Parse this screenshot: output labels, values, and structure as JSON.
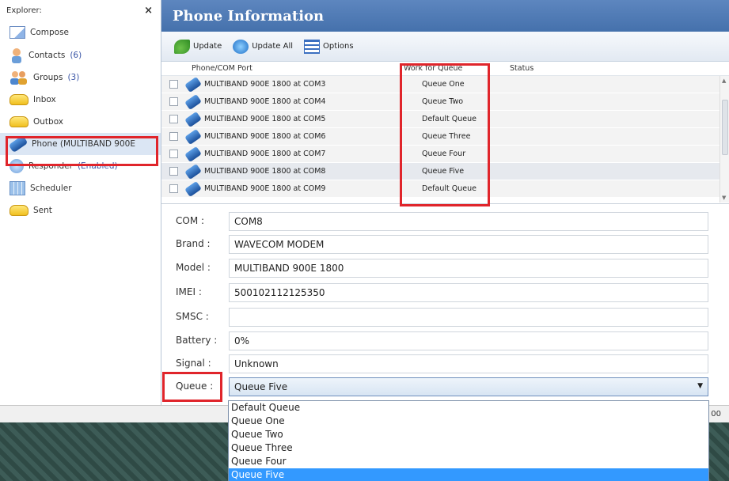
{
  "explorer": {
    "title": "Explorer:",
    "close": "×",
    "items": [
      {
        "label": "Compose",
        "count": ""
      },
      {
        "label": "Contacts",
        "count": "(6)"
      },
      {
        "label": "Groups",
        "count": "(3)"
      },
      {
        "label": "Inbox",
        "count": ""
      },
      {
        "label": "Outbox",
        "count": ""
      },
      {
        "label": "Phone  (MULTIBAND  900E",
        "count": ""
      },
      {
        "label": "Responder",
        "count": "(Enabled)"
      },
      {
        "label": "Scheduler",
        "count": ""
      },
      {
        "label": "Sent",
        "count": ""
      }
    ],
    "selected_index": 5
  },
  "panel": {
    "title": "Phone Information",
    "toolbar": {
      "update": "Update",
      "update_all": "Update All",
      "options": "Options"
    }
  },
  "grid": {
    "headers": {
      "port": "Phone/COM Port",
      "queue": "Work for Queue",
      "status": "Status"
    },
    "rows": [
      {
        "port": "MULTIBAND  900E  1800  at COM3",
        "queue": "Queue One",
        "status": ""
      },
      {
        "port": "MULTIBAND  900E  1800  at COM4",
        "queue": "Queue Two",
        "status": ""
      },
      {
        "port": "MULTIBAND  900E  1800  at COM5",
        "queue": "Default Queue",
        "status": ""
      },
      {
        "port": "MULTIBAND  900E  1800  at COM6",
        "queue": "Queue Three",
        "status": ""
      },
      {
        "port": "MULTIBAND  900E  1800  at COM7",
        "queue": "Queue Four",
        "status": ""
      },
      {
        "port": "MULTIBAND  900E  1800  at COM8",
        "queue": "Queue Five",
        "status": ""
      },
      {
        "port": "MULTIBAND  900E  1800  at COM9",
        "queue": "Default Queue",
        "status": ""
      }
    ]
  },
  "details": {
    "com": {
      "label": "COM :",
      "value": "COM8"
    },
    "brand": {
      "label": "Brand :",
      "value": "WAVECOM MODEM"
    },
    "model": {
      "label": "Model :",
      "value": "MULTIBAND  900E  1800"
    },
    "imei": {
      "label": "IMEI :",
      "value": "500102112125350"
    },
    "smsc": {
      "label": "SMSC :",
      "value": ""
    },
    "battery": {
      "label": "Battery :",
      "value": "0%"
    },
    "signal": {
      "label": "Signal :",
      "value": "Unknown"
    },
    "queue": {
      "label": "Queue :",
      "value": "Queue Five"
    }
  },
  "queue_options": [
    "Default Queue",
    "Queue One",
    "Queue Two",
    "Queue Three",
    "Queue Four",
    "Queue Five"
  ],
  "statusbar": {
    "text": "00"
  },
  "colors": {
    "title_bar": "#4571ac",
    "highlight_box": "#e0252b",
    "dropdown_selected": "#3399ff"
  }
}
